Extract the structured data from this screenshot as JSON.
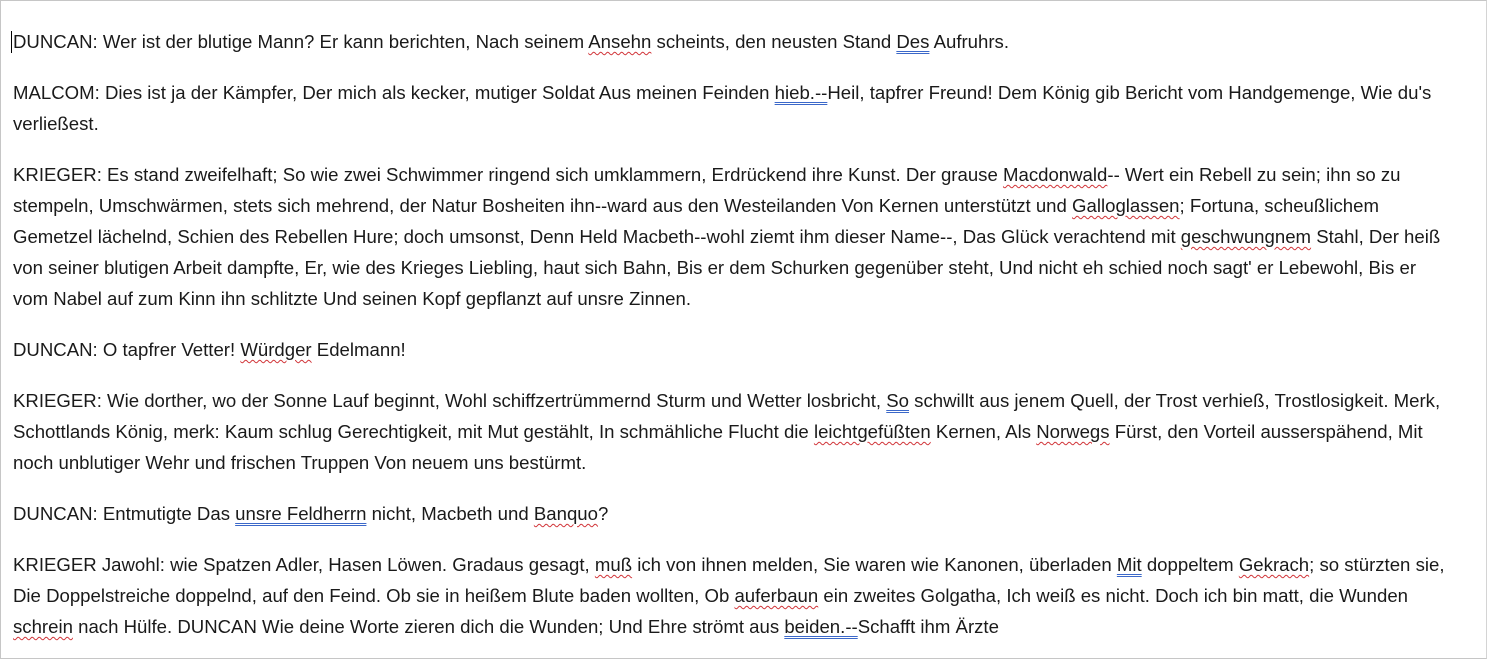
{
  "document": {
    "paragraphs": [
      [
        {
          "t": "DUNCAN: Wer ist der blutige Mann? Er kann berichten, Nach seinem "
        },
        {
          "t": "Ansehn",
          "m": "sp"
        },
        {
          "t": " scheints, den neusten Stand "
        },
        {
          "t": "Des",
          "m": "gr"
        },
        {
          "t": " Aufruhrs."
        }
      ],
      [
        {
          "t": "MALCOM: Dies ist ja der Kämpfer, Der mich als kecker, mutiger Soldat Aus meinen Feinden "
        },
        {
          "t": "hieb.--",
          "m": "gr"
        },
        {
          "t": "Heil, tapfrer Freund! Dem König gib Bericht vom Handgemenge, Wie du's verließest."
        }
      ],
      [
        {
          "t": "KRIEGER: Es stand zweifelhaft; So wie zwei Schwimmer ringend sich umklammern, Erdrückend ihre Kunst. Der grause "
        },
        {
          "t": "Macdonwald",
          "m": "sp"
        },
        {
          "t": "-- Wert ein Rebell zu sein; ihn so zu stempeln, Umschwärmen, stets sich mehrend, der Natur Bosheiten ihn--ward aus den Westeilanden Von Kernen unterstützt und "
        },
        {
          "t": "Galloglassen",
          "m": "sp"
        },
        {
          "t": "; Fortuna, scheußlichem Gemetzel lächelnd, Schien des Rebellen Hure; doch umsonst, Denn Held Macbeth--wohl ziemt ihm dieser Name--, Das Glück verachtend mit "
        },
        {
          "t": "geschwungnem",
          "m": "sp"
        },
        {
          "t": " Stahl, Der heiß von seiner blutigen Arbeit dampfte, Er, wie des Krieges Liebling, haut sich Bahn, Bis er dem Schurken gegenüber steht, Und nicht eh schied noch sagt' er Lebewohl, Bis er vom Nabel auf zum Kinn ihn schlitzte Und seinen Kopf gepflanzt auf unsre Zinnen."
        }
      ],
      [
        {
          "t": "DUNCAN: O tapfrer Vetter! "
        },
        {
          "t": "Würdger",
          "m": "sp"
        },
        {
          "t": " Edelmann!"
        }
      ],
      [
        {
          "t": "KRIEGER: Wie dorther, wo der Sonne Lauf beginnt, Wohl schiffzertrümmernd Sturm und Wetter losbricht, "
        },
        {
          "t": "So",
          "m": "gr"
        },
        {
          "t": " schwillt aus jenem Quell, der Trost verhieß, Trostlosigkeit. Merk, Schottlands König, merk: Kaum schlug Gerechtigkeit, mit Mut gestählt, In schmähliche Flucht die "
        },
        {
          "t": "leichtgefüßten",
          "m": "sp"
        },
        {
          "t": " Kernen, Als "
        },
        {
          "t": "Norwegs",
          "m": "sp"
        },
        {
          "t": " Fürst, den Vorteil ausserspähend, Mit noch unblutiger Wehr und frischen Truppen Von neuem uns bestürmt."
        }
      ],
      [
        {
          "t": "DUNCAN: Entmutigte Das "
        },
        {
          "t": "unsre Feldherrn",
          "m": "gr"
        },
        {
          "t": " nicht, Macbeth und "
        },
        {
          "t": "Banquo",
          "m": "sp"
        },
        {
          "t": "?"
        }
      ],
      [
        {
          "t": "KRIEGER Jawohl: wie Spatzen Adler, Hasen Löwen. Gradaus gesagt, "
        },
        {
          "t": "muß",
          "m": "sp"
        },
        {
          "t": " ich von ihnen melden, Sie waren wie Kanonen, überladen "
        },
        {
          "t": "Mit",
          "m": "gr"
        },
        {
          "t": " doppeltem "
        },
        {
          "t": "Gekrach",
          "m": "sp"
        },
        {
          "t": "; so stürzten sie, Die Doppelstreiche doppelnd, auf den Feind. Ob sie in heißem Blute baden wollten, Ob "
        },
        {
          "t": "auferbaun",
          "m": "sp"
        },
        {
          "t": " ein zweites Golgatha, Ich weiß es nicht. Doch ich bin matt, die Wunden "
        },
        {
          "t": "schrein",
          "m": "sp"
        },
        {
          "t": " nach Hülfe. DUNCAN Wie deine Worte zieren dich die Wunden; Und Ehre strömt aus "
        },
        {
          "t": "beiden.--",
          "m": "gr"
        },
        {
          "t": "Schafft ihm Ärzte"
        }
      ]
    ]
  },
  "colors": {
    "text": "#1a1a1a",
    "spelling_underline": "#d13438",
    "grammar_underline": "#3b68c9",
    "page_background": "#ffffff"
  }
}
